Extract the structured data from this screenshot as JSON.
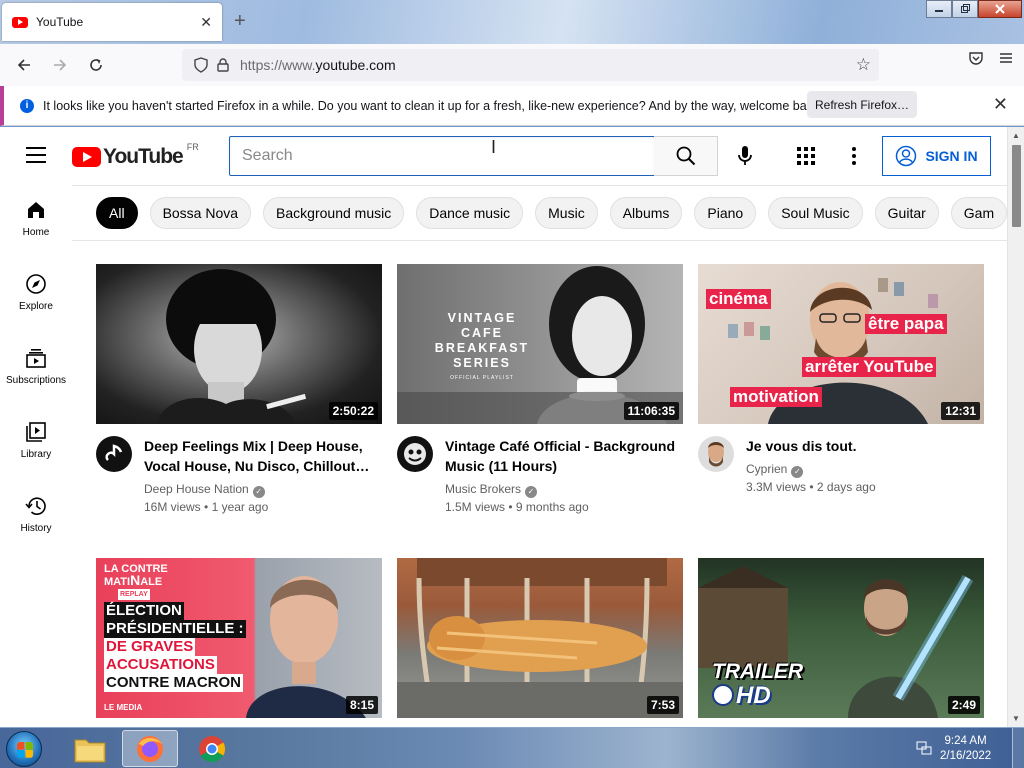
{
  "browser": {
    "tab_title": "YouTube",
    "tab_close": "✕",
    "new_tab": "+",
    "url_prefix": "https://www.",
    "url_domain": "youtube.com",
    "notification": "It looks like you haven't started Firefox in a while. Do you want to clean it up for a fresh, like-new experience? And by the way, welcome back!",
    "refresh_button": "Refresh Firefox…"
  },
  "youtube": {
    "logo_text": "YouTube",
    "country_code": "FR",
    "search_placeholder": "Search",
    "sign_in": "SIGN IN",
    "chips": [
      "All",
      "Bossa Nova",
      "Background music",
      "Dance music",
      "Music",
      "Albums",
      "Piano",
      "Soul Music",
      "Guitar",
      "Gam"
    ],
    "sidebar": [
      {
        "label": "Home",
        "icon": "home-icon"
      },
      {
        "label": "Explore",
        "icon": "explore-icon"
      },
      {
        "label": "Subscriptions",
        "icon": "subscriptions-icon"
      },
      {
        "label": "Library",
        "icon": "library-icon"
      },
      {
        "label": "History",
        "icon": "history-icon"
      }
    ],
    "videos": [
      {
        "title": "Deep Feelings Mix | Deep House, Vocal House, Nu Disco, Chillout…",
        "channel": "Deep House Nation",
        "verified": true,
        "views": "16M views",
        "age": "1 year ago",
        "duration": "2:50:22"
      },
      {
        "title": "Vintage Café Official - Background Music (11 Hours)",
        "channel": "Music Brokers",
        "verified": true,
        "views": "1.5M views",
        "age": "9 months ago",
        "duration": "11:06:35",
        "thumb_text": [
          "VINTAGE",
          "CAFE",
          "BREAKFAST",
          "SERIES"
        ],
        "thumb_sub": "OFFICIAL PLAYLIST"
      },
      {
        "title": "Je vous dis tout.",
        "channel": "Cyprien",
        "verified": true,
        "views": "3.3M views",
        "age": "2 days ago",
        "duration": "12:31",
        "thumb_labels": [
          "cinéma",
          "être papa",
          "arrêter YouTube",
          "motivation"
        ]
      },
      {
        "duration": "8:15",
        "thumb_badge": [
          "LA CON",
          "TRE",
          "MATI",
          "N",
          "ALE"
        ],
        "thumb_badge_sub": "REPLAY",
        "thumb_lines": [
          "ÉLECTION",
          "PRÉSIDENTIELLE :"
        ],
        "thumb_lines_red": [
          "DE GRAVES",
          "ACCUSATIONS"
        ],
        "thumb_line_last": "CONTRE MACRON",
        "thumb_logo": "LE MEDIA"
      },
      {
        "duration": "7:53"
      },
      {
        "duration": "2:49",
        "thumb_trailer": "TRAILER",
        "thumb_hd": "HD"
      }
    ]
  },
  "taskbar": {
    "time": "9:24 AM",
    "date": "2/16/2022"
  },
  "colors": {
    "yt_red": "#ff0000",
    "signin_blue": "#065fd4",
    "chip_active": "#030303"
  }
}
